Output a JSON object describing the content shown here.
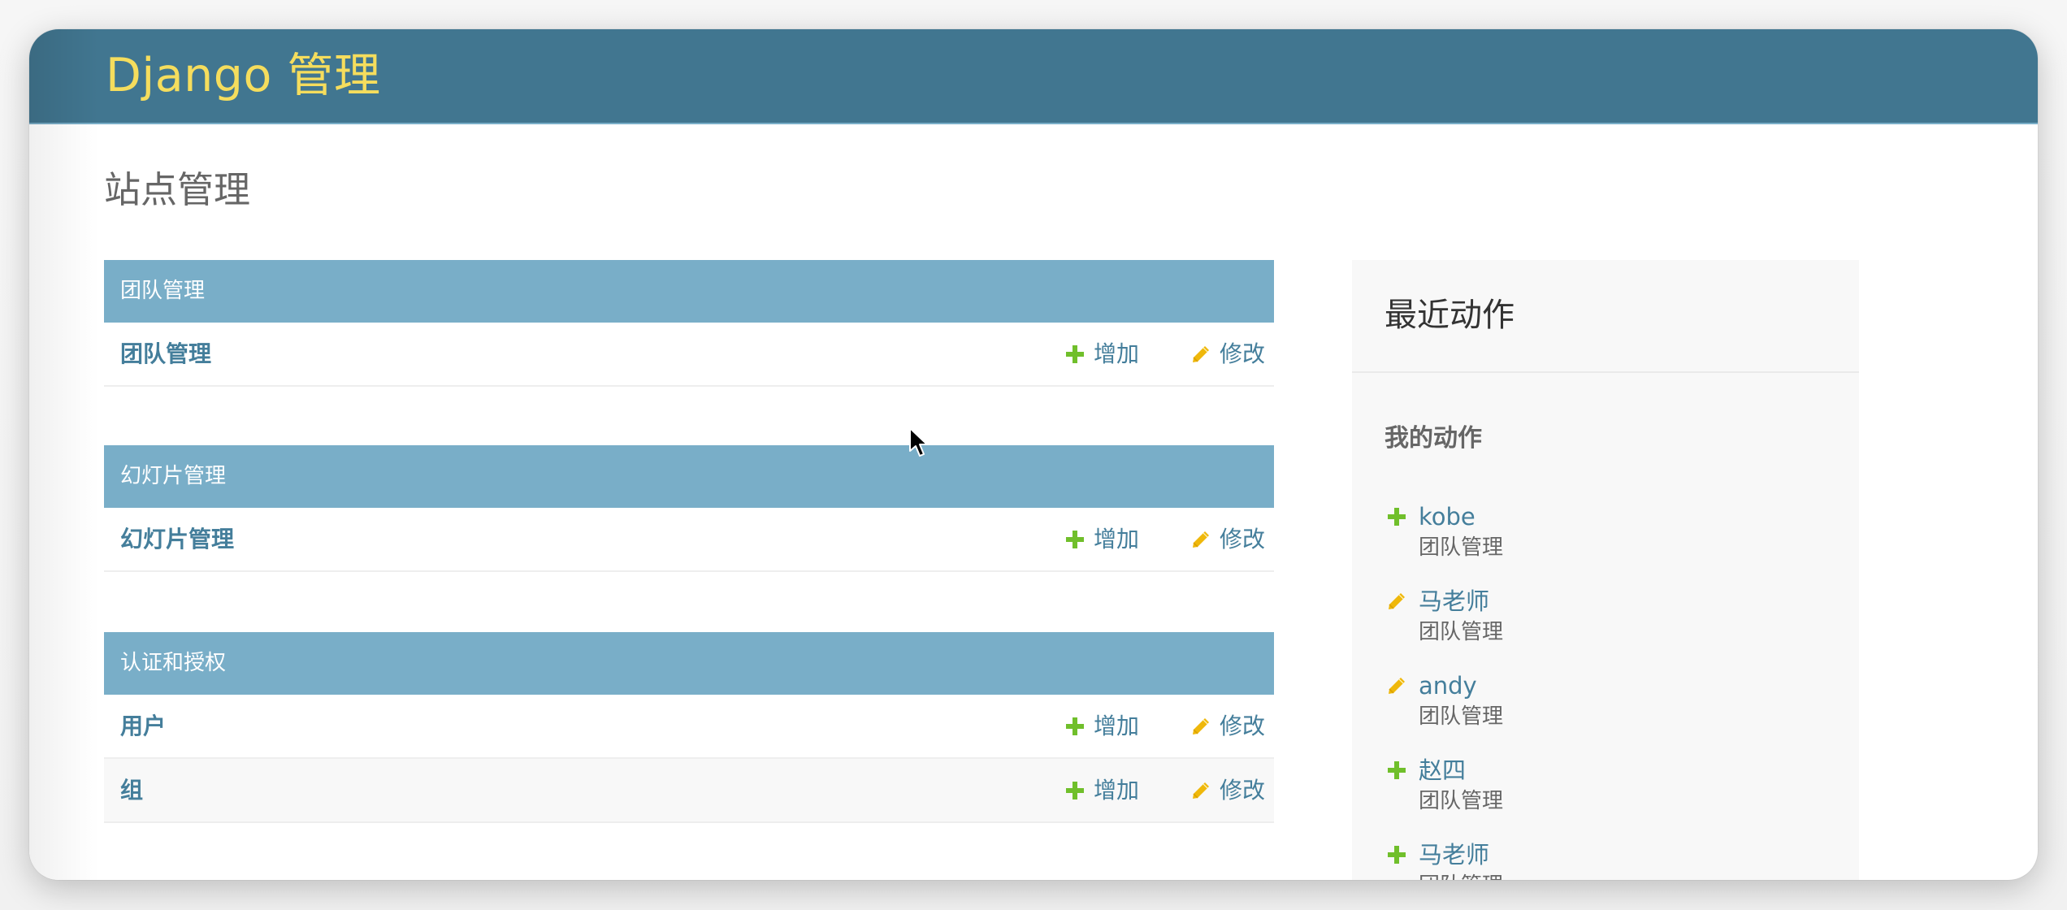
{
  "header": {
    "branding": "Django 管理"
  },
  "page": {
    "title": "站点管理"
  },
  "modules": [
    {
      "caption": "团队管理",
      "rows": [
        {
          "name": "团队管理",
          "add_label": "增加",
          "change_label": "修改"
        }
      ]
    },
    {
      "caption": "幻灯片管理",
      "rows": [
        {
          "name": "幻灯片管理",
          "add_label": "增加",
          "change_label": "修改"
        }
      ]
    },
    {
      "caption": "认证和授权",
      "rows": [
        {
          "name": "用户",
          "add_label": "增加",
          "change_label": "修改"
        },
        {
          "name": "组",
          "add_label": "增加",
          "change_label": "修改"
        }
      ]
    }
  ],
  "recent_actions": {
    "title": "最近动作",
    "subtitle": "我的动作",
    "items": [
      {
        "icon": "add-icon",
        "name": "kobe",
        "model": "团队管理"
      },
      {
        "icon": "change-icon",
        "name": "马老师",
        "model": "团队管理"
      },
      {
        "icon": "change-icon",
        "name": "andy",
        "model": "团队管理"
      },
      {
        "icon": "add-icon",
        "name": "赵四",
        "model": "团队管理"
      },
      {
        "icon": "add-icon",
        "name": "马老师",
        "model": "团队管理"
      }
    ]
  },
  "colors": {
    "header_bg": "#417690",
    "branding": "#f5dd5d",
    "caption_bg": "#79aec8",
    "link": "#447e9b",
    "add_icon": "#70bf2b",
    "change_icon": "#efb80b"
  }
}
